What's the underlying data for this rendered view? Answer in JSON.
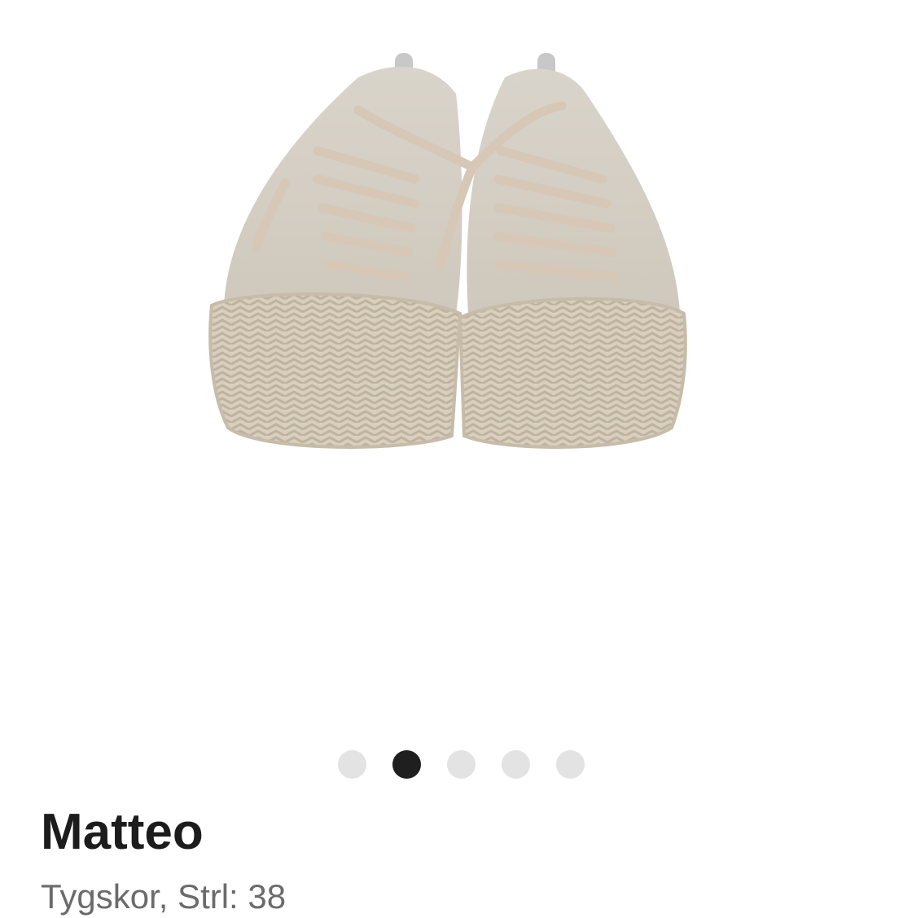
{
  "product": {
    "image_alt": "shoe-photo",
    "title": "Matteo",
    "subtitle": "Tygskor, Strl: 38"
  },
  "gallery": {
    "total_images": 5,
    "active_index": 1
  },
  "colors": {
    "dot_inactive": "#e3e3e3",
    "dot_active": "#1f1f1f",
    "title": "#1c1c1c",
    "subtitle": "#6b6b6b"
  }
}
